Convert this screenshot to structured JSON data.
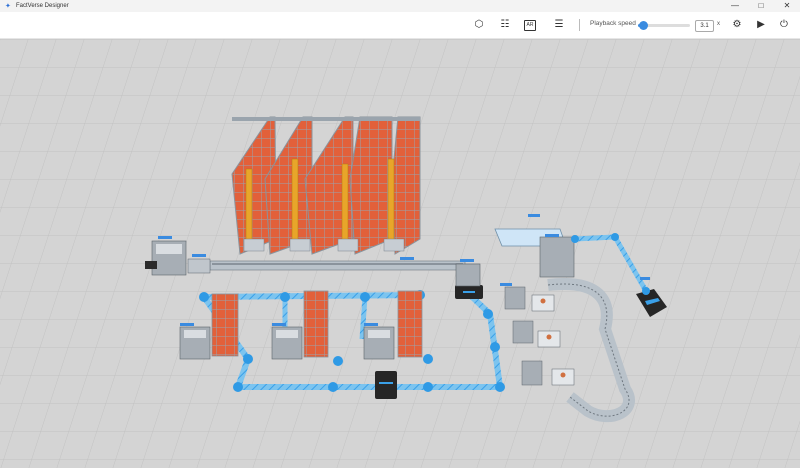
{
  "window": {
    "title": "FactVerse Designer",
    "minimize": "—",
    "maximize": "□",
    "close": "✕"
  },
  "toolbar": {
    "playback_label": "Playback speed",
    "speed_value": "3.1",
    "speed_unit": "x",
    "speed_fraction": 0.1,
    "icons": {
      "view_3d": "⬡",
      "hierarchy": "☷",
      "ar": "AR",
      "document": "☰",
      "settings": "⚙",
      "play": "▶",
      "power": "⏻"
    }
  },
  "colors": {
    "accent": "#3a8be0",
    "floor": "#d4d4d4",
    "conveyor": "#3aa0e8",
    "racking": "#e2603a",
    "stacker": "#e8a52a"
  }
}
